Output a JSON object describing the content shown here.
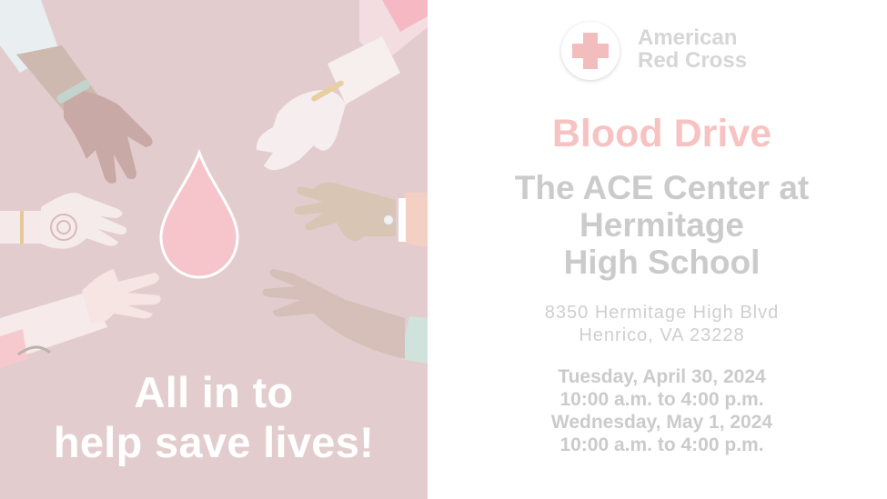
{
  "colors": {
    "left_background": "#e3ccce",
    "drop_fill": "#f6c4cb",
    "title_color": "#f7c3c2",
    "text_gray": "#cbcbcb",
    "logo_red": "#f3bdbd"
  },
  "logo": {
    "icon": "red-cross-icon",
    "line1": "American",
    "line2": "Red Cross"
  },
  "illustration": {
    "icon": "blood-drop-icon",
    "hands": 7
  },
  "tagline": {
    "line1": "All in to",
    "line2": "help save lives!"
  },
  "event": {
    "title": "Blood Drive",
    "venue_line1": "The ACE Center at",
    "venue_line2": "Hermitage",
    "venue_line3": "High School",
    "address_line1": "8350 Hermitage High Blvd",
    "address_line2": "Henrico, VA 23228",
    "schedule": [
      {
        "date": "Tuesday, April 30, 2024",
        "time": "10:00 a.m. to 4:00 p.m."
      },
      {
        "date": "Wednesday, May 1, 2024",
        "time": "10:00 a.m. to 4:00 p.m."
      }
    ]
  }
}
